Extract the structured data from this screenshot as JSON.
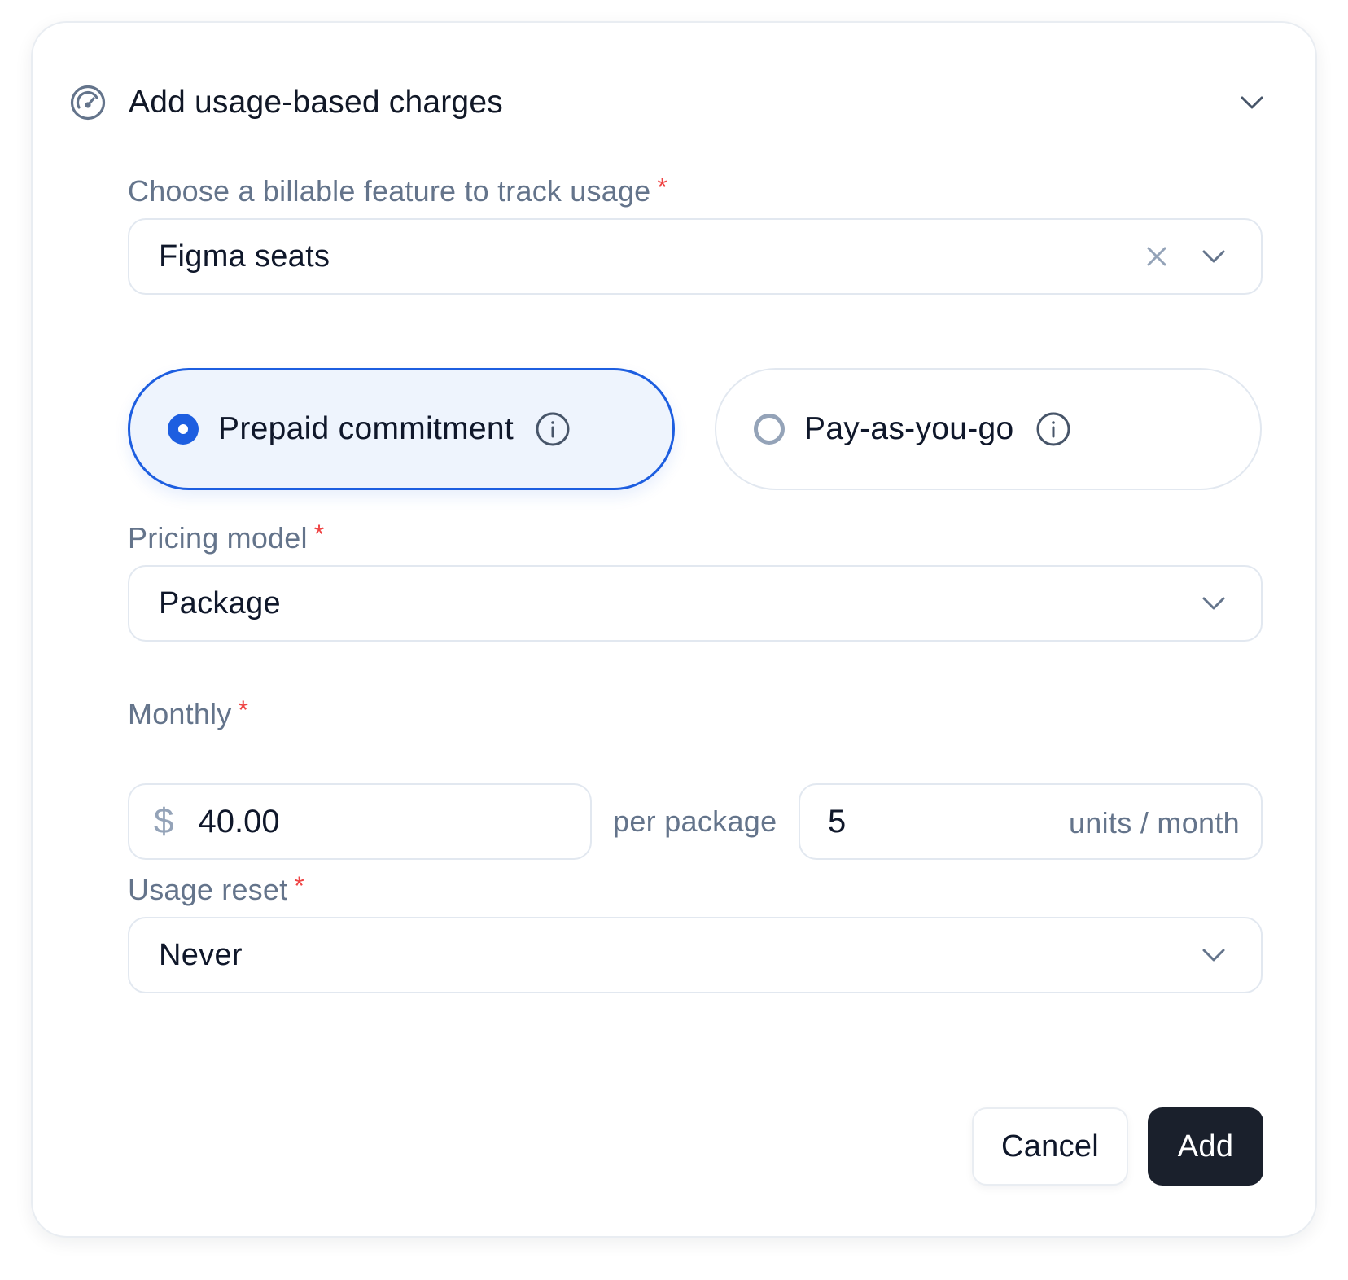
{
  "header": {
    "title": "Add usage-based charges",
    "icon": "gauge-icon",
    "collapse_icon": "chevron-down-icon"
  },
  "feature": {
    "label": "Choose a billable feature to track usage",
    "required_mark": "*",
    "value": "Figma seats"
  },
  "billing_options": [
    {
      "label": "Prepaid commitment",
      "selected": true
    },
    {
      "label": "Pay-as-you-go",
      "selected": false
    }
  ],
  "pricing_model": {
    "label": "Pricing model",
    "required_mark": "*",
    "value": "Package"
  },
  "monthly": {
    "label": "Monthly",
    "required_mark": "*",
    "currency_symbol": "$",
    "amount": "40.00",
    "per_label": "per package",
    "units_value": "5",
    "units_suffix": "units / month"
  },
  "usage_reset": {
    "label": "Usage reset",
    "required_mark": "*",
    "value": "Never"
  },
  "actions": {
    "cancel_label": "Cancel",
    "add_label": "Add"
  },
  "colors": {
    "accent": "#1d5ee0",
    "selected_bg": "#eef4fd",
    "primary_button": "#1a202c",
    "required": "#ef4444",
    "muted_text": "#64748b"
  }
}
